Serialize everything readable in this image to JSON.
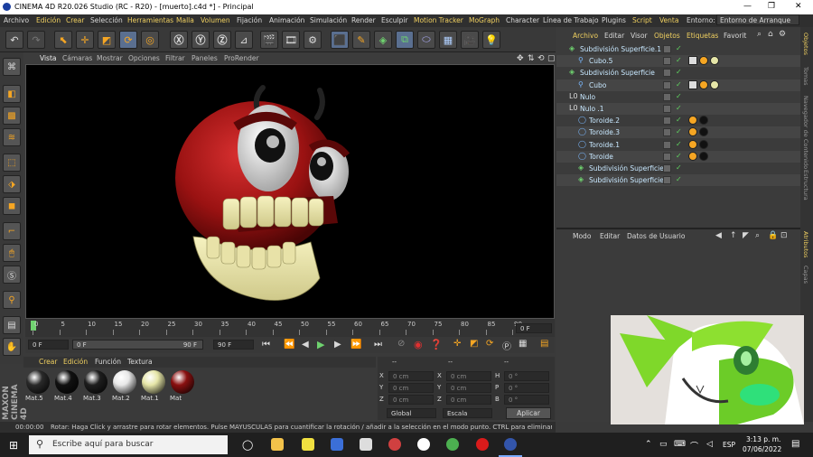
{
  "window": {
    "title": "CINEMA 4D R20.026 Studio (RC - R20) - [muerto].c4d *] - Principal"
  },
  "menu": [
    {
      "label": "Archivo"
    },
    {
      "label": "Edición"
    },
    {
      "label": "Crear"
    },
    {
      "label": "Selección"
    },
    {
      "label": "Herramientas"
    },
    {
      "label": "Malla"
    },
    {
      "label": "Volumen"
    },
    {
      "label": "Fijación"
    },
    {
      "label": "Animación"
    },
    {
      "label": "Simulación"
    },
    {
      "label": "Render"
    },
    {
      "label": "Esculpir"
    },
    {
      "label": "Motion Tracker"
    },
    {
      "label": "MoGraph"
    },
    {
      "label": "Character"
    },
    {
      "label": "Línea de Trabajo"
    },
    {
      "label": "Plugins"
    },
    {
      "label": "Script"
    },
    {
      "label": "Ventana"
    }
  ],
  "environment": {
    "label": "Entorno:",
    "value": "Entorno de Arranque"
  },
  "viewport_menu": [
    "Vista",
    "Cámaras",
    "Mostrar",
    "Opciones",
    "Filtrar",
    "Paneles",
    "ProRender"
  ],
  "timeline": {
    "ticks": [
      "0",
      "5",
      "10",
      "15",
      "20",
      "25",
      "30",
      "35",
      "40",
      "45",
      "50",
      "55",
      "60",
      "65",
      "70",
      "75",
      "80",
      "85",
      "90"
    ],
    "current_frame": "0 F",
    "start_field": "0 F",
    "slider_start": "0 F",
    "slider_end": "90 F",
    "end_field": "90 F"
  },
  "material_menu": [
    "Crear",
    "Edición",
    "Función",
    "Textura"
  ],
  "materials": [
    {
      "name": "Mat.5",
      "color": "#2a2a2a"
    },
    {
      "name": "Mat.4",
      "color": "#111111"
    },
    {
      "name": "Mat.3",
      "color": "#1e1e1e"
    },
    {
      "name": "Mat.2",
      "color": "#e8e8e8"
    },
    {
      "name": "Mat.1",
      "color": "#e6e6a8"
    },
    {
      "name": "Mat",
      "color": "#8a1010"
    }
  ],
  "coords": {
    "header": [
      "--",
      "--",
      "--"
    ],
    "rows": [
      {
        "a": "X",
        "av": "0 cm",
        "b": "X",
        "bv": "0 cm",
        "c": "H",
        "cv": "0 °"
      },
      {
        "a": "Y",
        "av": "0 cm",
        "b": "Y",
        "bv": "0 cm",
        "c": "P",
        "cv": "0 °"
      },
      {
        "a": "Z",
        "av": "0 cm",
        "b": "Z",
        "bv": "0 cm",
        "c": "B",
        "cv": "0 °"
      }
    ],
    "mode1": "Global",
    "mode2": "Escala",
    "apply": "Aplicar"
  },
  "status": {
    "time": "00:00:00",
    "message": "Rotar: Haga Click y arrastre para rotar elementos. Pulse MAYUSCULAS para cuantificar la rotación / añadir a la selección en el modo punto. CTRL para eliminar."
  },
  "object_manager": {
    "menu": [
      "Archivo",
      "Editar",
      "Visor",
      "Objetos",
      "Etiquetas",
      "Favorit"
    ],
    "objects": [
      {
        "name": "Subdivisión Superficie.1",
        "indent": 0
      },
      {
        "name": "Cubo.5",
        "indent": 1
      },
      {
        "name": "Subdivisión Superficie",
        "indent": 0
      },
      {
        "name": "Cubo",
        "indent": 1
      },
      {
        "name": "Nulo",
        "indent": 0
      },
      {
        "name": "Nulo .1",
        "indent": 0
      },
      {
        "name": "Toroide.2",
        "indent": 1
      },
      {
        "name": "Toroide.3",
        "indent": 1
      },
      {
        "name": "Toroide.1",
        "indent": 1
      },
      {
        "name": "Toroide",
        "indent": 1
      },
      {
        "name": "Subdivisión Superficie.1",
        "indent": 1
      },
      {
        "name": "Subdivisión Superficie",
        "indent": 1
      }
    ]
  },
  "attributes": {
    "menu": [
      "Modo",
      "Editar",
      "Datos de Usuario"
    ]
  },
  "side_tabs": [
    "Objetos",
    "Tomas",
    "Navegador de Contenido",
    "Estructura",
    "Atributos",
    "Capas"
  ],
  "branding": {
    "text": "MAXON CINEMA 4D"
  },
  "taskbar": {
    "search_placeholder": "Escribe aquí para buscar",
    "lang": "ESP",
    "time": "3:13 p. m.",
    "date": "07/06/2022"
  }
}
